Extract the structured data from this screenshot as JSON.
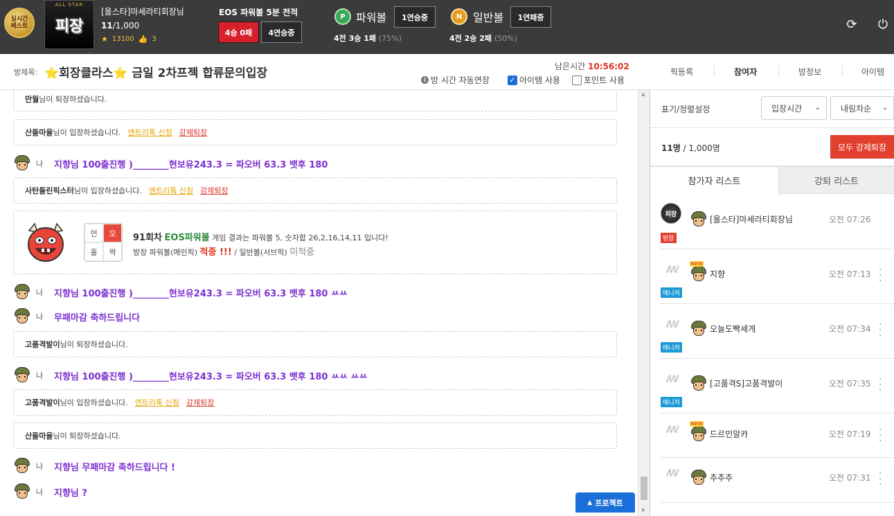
{
  "topbar": {
    "best_badge_line1": "실시간",
    "best_badge_line2": "베스트",
    "host_image_text": "피장",
    "host_image_top": "ALL STAR",
    "host_name": "[올스타]마세라티회장님",
    "member_count": "11",
    "member_max": "/1,000",
    "points": "13100",
    "likes": "3",
    "eos_title": "EOS 파워볼 5분 전적",
    "record_btn": "4승 0패",
    "streak_btn": "4연승중",
    "powerball_icon": "P",
    "powerball_label": "파워볼",
    "powerball_streak": "1연승중",
    "powerball_record": "4전 3승 1패",
    "powerball_rate": "(75%)",
    "normalball_icon": "N",
    "normalball_label": "일반볼",
    "normalball_streak": "1연패중",
    "normalball_record": "4전 2승 2패",
    "normalball_rate": "(50%)",
    "refresh_icon": "⟳",
    "power_icon": "⏻"
  },
  "roombar": {
    "label": "방제목:",
    "title": "⭐회장클라스⭐ 금일 2차프젝 합류문의입장",
    "remain_label": "남은시간",
    "remain_time": "10:56:02",
    "auto_extend": "방 시간 자동연장",
    "item_use": "아이템 사용",
    "item_checked": true,
    "point_use": "포인트 사용",
    "point_checked": false,
    "tabs": [
      "픽등록",
      "참여자",
      "방정보",
      "아이템"
    ]
  },
  "chat": {
    "me_label": "나",
    "sys_suffix_leave": "님이 퇴장하셨습니다.",
    "sys_suffix_enter": "님이 입장하셨습니다.",
    "entry_link": "엔트리톡 신청",
    "kick_link": "강제퇴장",
    "items": [
      {
        "type": "sys",
        "user": "만월",
        "action": "leave"
      },
      {
        "type": "sys",
        "user": "산들마을",
        "action": "enter"
      },
      {
        "type": "msg",
        "text": "지향님 100출진행 )________현보유243.3 = 파오버 63.3 뱃후 180"
      },
      {
        "type": "sys",
        "user": "사탄들린픽스터",
        "action": "enter"
      },
      {
        "type": "game"
      },
      {
        "type": "msg",
        "text": "지향님 100출진행 )________현보유243.3 = 파오버 63.3 뱃후 180 ㅆㅆ"
      },
      {
        "type": "msg",
        "text": "무패마감 축하드립니다"
      },
      {
        "type": "sys",
        "user": "고품격발이",
        "action": "leave"
      },
      {
        "type": "msg",
        "text": "지향님 100출진행 )________현보유243.3 = 파오버 63.3 뱃후 180 ㅆㅆ ㅆㅆ"
      },
      {
        "type": "sys",
        "user": "고품격발이",
        "action": "enter"
      },
      {
        "type": "sys",
        "user": "산들마을",
        "action": "leave"
      },
      {
        "type": "msg",
        "text": "지향님 무패마감 축하드립니다 !"
      },
      {
        "type": "msg",
        "text": "지향님 ?"
      }
    ],
    "game": {
      "grid": [
        "언",
        "오",
        "홀",
        "짝"
      ],
      "round": "91회차",
      "game_name": "EOS파워볼",
      "result_text": "게임 결과는 파워볼 5, 숫자합 26,2,16,14,11 입니다!",
      "host_pick_label": "방장 파워볼(메인픽)",
      "host_pick_result": "적중 !!!",
      "separator": "/",
      "sub_pick_label": "일반볼(서브픽)",
      "sub_pick_result": "미적중"
    },
    "project_btn": "프로젝트",
    "project_icon": "▲"
  },
  "panel": {
    "sort_label": "표기/정렬설정",
    "sort_select": "입장시간",
    "order_select": "내림차순",
    "count_bold": "11명",
    "count_rest": " / 1,000명",
    "kick_all": "모두 강제퇴장",
    "tab_participants": "참가자 리스트",
    "tab_kicked": "강퇴 리스트",
    "participants": [
      {
        "name": "[올스타]마세라티회장님",
        "time": "오전 07:26",
        "badge": "방장",
        "role": "host",
        "new": false
      },
      {
        "name": "지향",
        "time": "오전 07:13",
        "badge": "매니저",
        "role": "mgr",
        "new": true
      },
      {
        "name": "오늘도빡세게",
        "time": "오전 07:34",
        "badge": "매니저",
        "role": "mgr",
        "new": false
      },
      {
        "name": "[고품격S]고품격발이",
        "time": "오전 07:35",
        "badge": "매니저",
        "role": "mgr",
        "new": false
      },
      {
        "name": "드르민알카",
        "time": "오전 07:19",
        "badge": "",
        "role": "",
        "new": true
      },
      {
        "name": "추추추",
        "time": "오전 07:31",
        "badge": "",
        "role": "",
        "new": false
      }
    ],
    "host_logo": "피장",
    "new_tag": "NEW"
  }
}
